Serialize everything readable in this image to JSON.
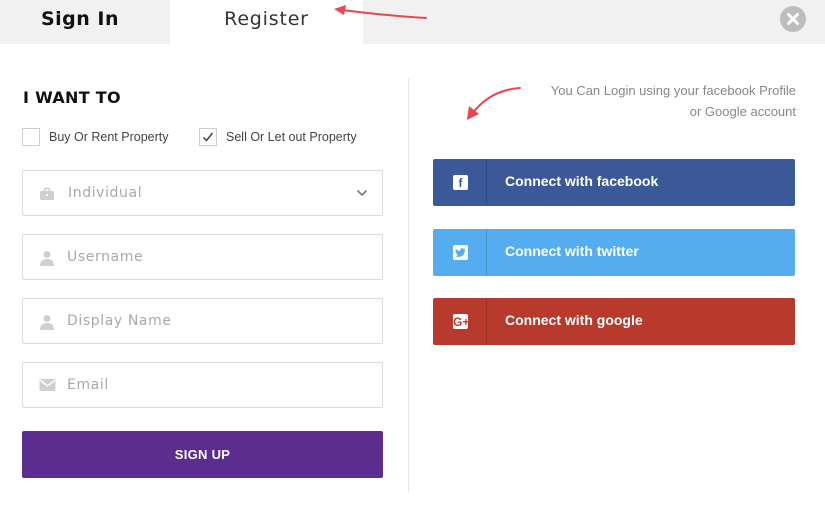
{
  "tabs": {
    "signin_label": "Sign In",
    "register_label": "Register"
  },
  "form": {
    "title": "I WANT TO",
    "options": [
      {
        "label": "Buy Or Rent Property",
        "checked": false
      },
      {
        "label": "Sell Or Let out Property",
        "checked": true
      }
    ],
    "account_type": {
      "value": "Individual",
      "icon": "briefcase-icon"
    },
    "username": {
      "placeholder": "Username",
      "icon": "user-icon"
    },
    "display_name": {
      "placeholder": "Display Name",
      "icon": "user-icon"
    },
    "email": {
      "placeholder": "Email",
      "icon": "envelope-icon"
    },
    "submit_label": "SIGN UP"
  },
  "social": {
    "help_line1": "You Can Login using your facebook Profile",
    "help_line2": "or Google account",
    "buttons": [
      {
        "label": "Connect with facebook",
        "icon": "facebook-icon",
        "color": "#3b5998"
      },
      {
        "label": "Connect with twitter",
        "icon": "twitter-icon",
        "color": "#55acee"
      },
      {
        "label": "Connect with google",
        "icon": "google-plus-icon",
        "color": "#b83a2c"
      }
    ]
  },
  "colors": {
    "accent": "#5b2d8e",
    "annotation": "#e8474f"
  }
}
